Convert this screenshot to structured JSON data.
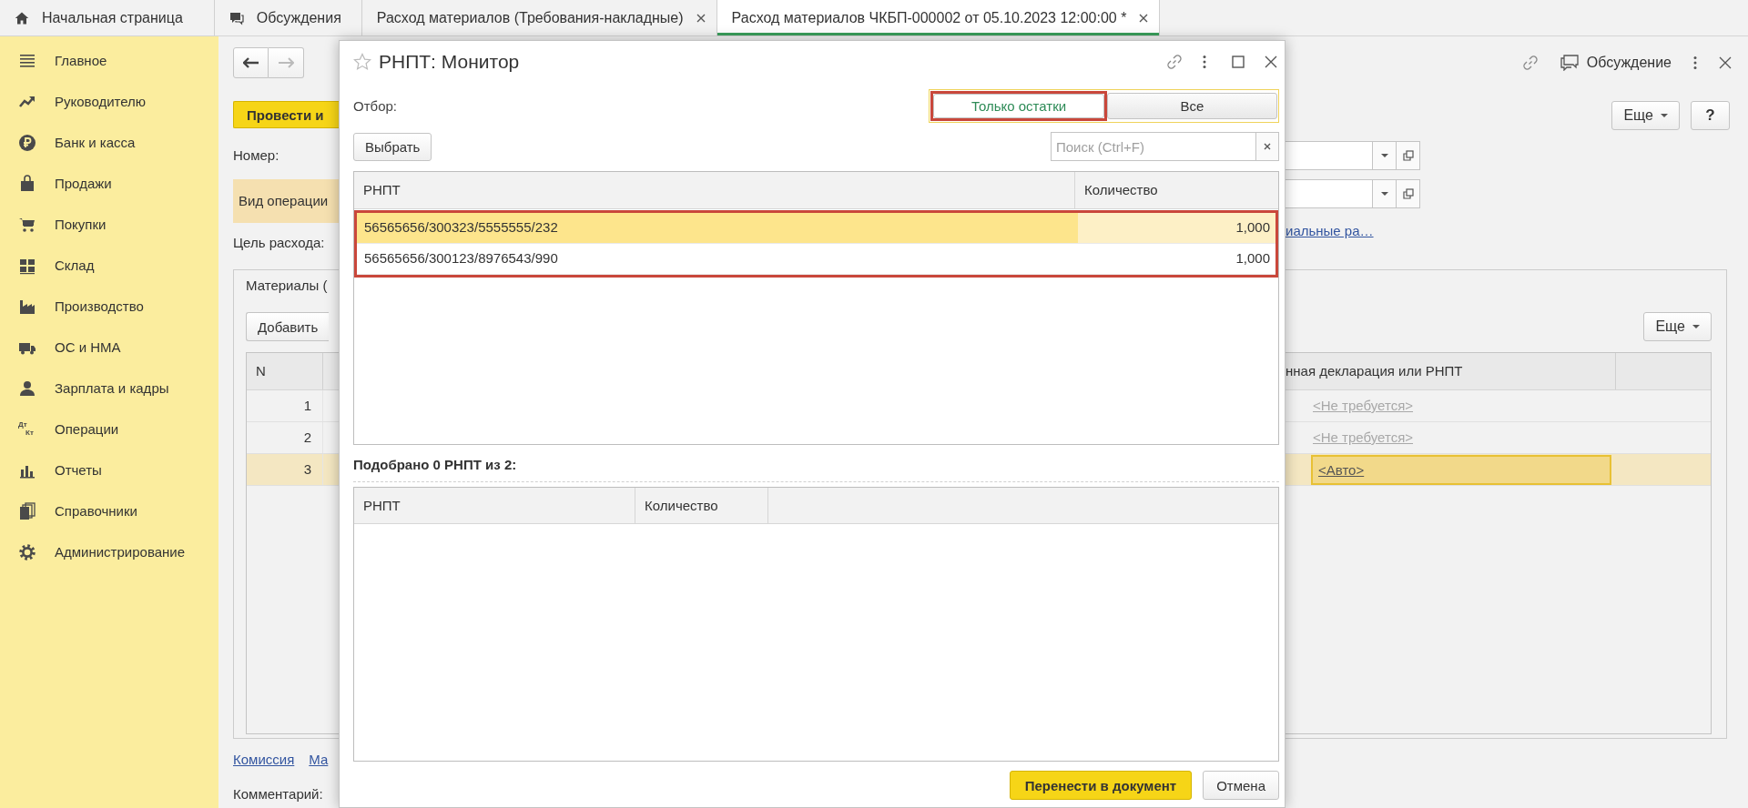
{
  "tabs": [
    {
      "label": "Начальная страница",
      "kind": "home",
      "closable": false,
      "selected": false
    },
    {
      "label": "Обсуждения",
      "kind": "discussions",
      "closable": false,
      "selected": false
    },
    {
      "label": "Расход материалов (Требования-накладные)",
      "kind": "document",
      "closable": true,
      "selected": false
    },
    {
      "label": "Расход материалов ЧКБП-000002 от 05.10.2023 12:00:00 *",
      "kind": "document",
      "closable": true,
      "selected": true
    }
  ],
  "sidebar": {
    "items": [
      {
        "label": "Главное",
        "kind": "menu"
      },
      {
        "label": "Руководителю",
        "kind": "trend"
      },
      {
        "label": "Банк и касса",
        "kind": "ruble"
      },
      {
        "label": "Продажи",
        "kind": "bag"
      },
      {
        "label": "Покупки",
        "kind": "cart"
      },
      {
        "label": "Склад",
        "kind": "tiles"
      },
      {
        "label": "Производство",
        "kind": "factory"
      },
      {
        "label": "ОС и НМА",
        "kind": "truck"
      },
      {
        "label": "Зарплата и кадры",
        "kind": "person"
      },
      {
        "label": "Операции",
        "kind": "dtkt",
        "icon_text": [
          "Дт",
          "Кт"
        ]
      },
      {
        "label": "Отчеты",
        "kind": "bars"
      },
      {
        "label": "Справочники",
        "kind": "books"
      },
      {
        "label": "Администрирование",
        "kind": "gear"
      }
    ]
  },
  "document": {
    "back_disabled": false,
    "forward_disabled": true,
    "post_button": "Провести и",
    "number_label": "Номер:",
    "operation_label": "Вид операции",
    "purpose_label": "Цель расхода:",
    "materials_tab": "Материалы (",
    "add_button": "Добавить",
    "discussion_button": "Обсуждение",
    "more_button": "Еще",
    "help_button": "?",
    "purpose_link": "иальные ра…",
    "table_more_button": "Еще",
    "table": {
      "columns": [
        "N",
        "нная декларация или РНПТ"
      ],
      "rows": [
        {
          "n": "1",
          "declaration": "<Не требуется>",
          "muted": true,
          "selected": false
        },
        {
          "n": "2",
          "declaration": "<Не требуется>",
          "muted": true,
          "selected": false
        },
        {
          "n": "3",
          "declaration": "<Авто>",
          "muted": false,
          "selected": true
        }
      ]
    },
    "bottom_links": [
      "Комиссия",
      "Ма"
    ],
    "comment_label": "Комментарий:"
  },
  "dialog": {
    "title": "РНПТ: Монитор",
    "filter_label": "Отбор:",
    "filter_options": [
      {
        "label": "Только остатки",
        "selected": true,
        "annotated": true
      },
      {
        "label": "Все",
        "selected": false,
        "annotated": false
      }
    ],
    "select_button": "Выбрать",
    "search": {
      "placeholder": "Поиск (Ctrl+F)"
    },
    "available": {
      "columns": [
        "РНПТ",
        "Количество"
      ],
      "annotated": true,
      "rows": [
        {
          "rnpt": "56565656/300323/5555555/232",
          "quantity": "1,000",
          "selected": true
        },
        {
          "rnpt": "56565656/300123/8976543/990",
          "quantity": "1,000",
          "selected": false
        }
      ]
    },
    "picked_caption": "Подобрано 0 РНПТ из 2:",
    "picked": {
      "columns": [
        "РНПТ",
        "Количество"
      ]
    },
    "buttons": [
      {
        "label": "Перенести в документ",
        "kind": "primary"
      },
      {
        "label": "Отмена",
        "kind": "secondary"
      }
    ]
  }
}
